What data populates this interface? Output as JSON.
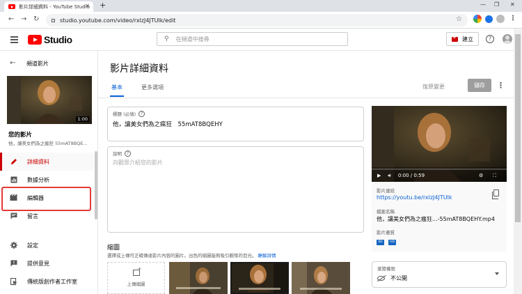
{
  "browser": {
    "tab_title": "影片詳細資料 - YouTube Studio",
    "new_tab": "+",
    "url": "studio.youtube.com/video/rxlzJ4JTUlk/edit"
  },
  "header": {
    "logo_text": "Studio",
    "search_placeholder": "在頻道中搜尋",
    "create_label": "建立"
  },
  "sidebar": {
    "back_title": "頻道影片",
    "thumb_duration": "1:00",
    "video_label": "您的影片",
    "video_name": "他，讓美女們為之瘋狂 55mAT8BQE...",
    "items": [
      {
        "label": "詳細資料",
        "icon": "pencil-icon",
        "active": true
      },
      {
        "label": "數據分析",
        "icon": "analytics-icon"
      },
      {
        "label": "編輯器",
        "icon": "editor-icon"
      },
      {
        "label": "留言",
        "icon": "comments-icon"
      }
    ],
    "bottom_items": [
      {
        "label": "設定",
        "icon": "gear-icon"
      },
      {
        "label": "提供意見",
        "icon": "feedback-icon"
      },
      {
        "label": "傳統版創作者工作室",
        "icon": "classic-studio-icon"
      }
    ]
  },
  "main": {
    "page_title": "影片詳細資料",
    "tabs": [
      {
        "label": "基本"
      },
      {
        "label": "更多選項"
      }
    ],
    "undo_label": "復原變更",
    "save_label": "儲存",
    "title_field": {
      "label": "標題 (必填)",
      "value": "他，讓美女們為之瘋狂　55mAT8BQEHY"
    },
    "desc_field": {
      "label": "說明",
      "placeholder": "向觀眾介紹您的影片"
    },
    "thumbnails": {
      "heading": "縮圖",
      "subtitle": "選擇或上傳可正確傳達影片內容的圖片。出色的縮圖能夠吸引觀眾的目光。",
      "learn_more": "瞭解詳情",
      "upload_label": "上傳縮圖"
    },
    "preview": {
      "time": "0:00 / 0:59",
      "link_label": "影片連結",
      "link_value": "https://youtu.be/rxlzJ4JTUlk",
      "file_label": "檔案名稱",
      "file_value": "他，讓美女們為之瘋狂...-55mAT8BQEHY.mp4",
      "quality_label": "影片畫質",
      "quality_badges": [
        "SD",
        "HD"
      ]
    },
    "visibility": {
      "label": "瀏覽權限",
      "value": "不公開"
    }
  },
  "colors": {
    "accent": "#065fd4",
    "brand_red": "#ff0000",
    "highlight_box": "#e53935"
  }
}
